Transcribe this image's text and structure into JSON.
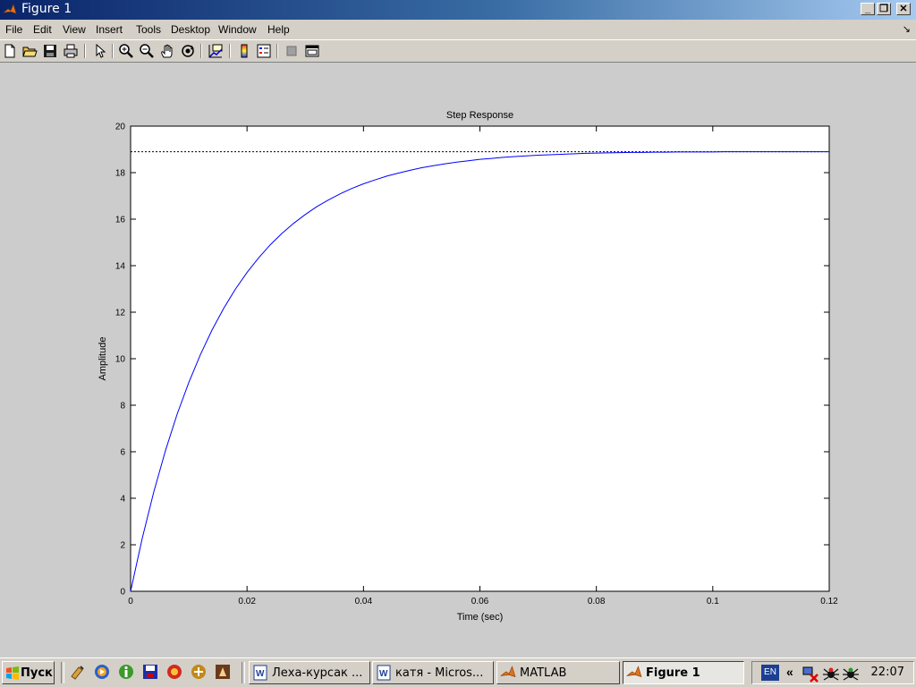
{
  "window": {
    "title": "Figure 1"
  },
  "titlebar_buttons": [
    "_",
    "❐",
    "✕"
  ],
  "menu": {
    "items": [
      "File",
      "Edit",
      "View",
      "Insert",
      "Tools",
      "Desktop",
      "Window",
      "Help"
    ],
    "corner": "↘"
  },
  "toolbar": {
    "icons": [
      "new-figure-icon",
      "open-file-icon",
      "save-icon",
      "print-icon",
      "select-arrow-icon",
      "zoom-in-icon",
      "zoom-out-icon",
      "pan-hand-icon",
      "rotate-3d-icon",
      "data-cursor-icon",
      "insert-colorbar-icon",
      "insert-legend-icon",
      "hide-plot-tools-icon",
      "show-plot-tools-icon"
    ]
  },
  "chart_data": {
    "type": "line",
    "title": "Step Response",
    "xlabel": "Time (sec)",
    "ylabel": "Amplitude",
    "xlim": [
      0,
      0.12
    ],
    "ylim": [
      0,
      20
    ],
    "xticks": [
      "0",
      "0.02",
      "0.04",
      "0.06",
      "0.08",
      "0.1",
      "0.12"
    ],
    "yticks": [
      "0",
      "2",
      "4",
      "6",
      "8",
      "10",
      "12",
      "14",
      "16",
      "18",
      "20"
    ],
    "grid": false,
    "steady_state": 18.9,
    "series": [
      {
        "color": "#0000ff",
        "x": [
          0,
          0.002,
          0.004,
          0.006,
          0.008,
          0.01,
          0.012,
          0.014,
          0.016,
          0.018,
          0.02,
          0.022,
          0.024,
          0.026,
          0.028,
          0.03,
          0.032,
          0.034,
          0.036,
          0.038,
          0.04,
          0.042,
          0.044,
          0.046,
          0.048,
          0.05,
          0.052,
          0.054,
          0.056,
          0.058,
          0.06,
          0.062,
          0.064,
          0.066,
          0.068,
          0.07,
          0.072,
          0.074,
          0.076,
          0.078,
          0.08,
          0.082,
          0.084,
          0.086,
          0.088,
          0.09,
          0.092,
          0.094,
          0.096,
          0.098,
          0.1,
          0.102,
          0.104,
          0.106,
          0.108,
          0.11,
          0.112,
          0.114,
          0.116,
          0.118,
          0.12
        ],
        "y": [
          0,
          2.28,
          4.29,
          6.06,
          7.62,
          8.98,
          10.18,
          11.24,
          12.17,
          12.99,
          13.71,
          14.34,
          14.9,
          15.39,
          15.82,
          16.2,
          16.54,
          16.83,
          17.09,
          17.32,
          17.52,
          17.69,
          17.85,
          17.98,
          18.1,
          18.21,
          18.3,
          18.38,
          18.45,
          18.51,
          18.57,
          18.61,
          18.66,
          18.69,
          18.72,
          18.75,
          18.77,
          18.79,
          18.81,
          18.83,
          18.84,
          18.85,
          18.86,
          18.87,
          18.87,
          18.88,
          18.88,
          18.89,
          18.89,
          18.89,
          18.89,
          18.9,
          18.9,
          18.9,
          18.9,
          18.9,
          18.9,
          18.9,
          18.9,
          18.9,
          18.9
        ]
      }
    ]
  },
  "taskbar": {
    "start_label": "Пуск",
    "quick_launch": [
      "show-desktop-icon",
      "media-player-icon",
      "messenger-icon",
      "save-disk-icon",
      "browser-icon",
      "app-icon",
      "app-icon-2"
    ],
    "buttons": [
      {
        "label": "Леха-курсак ...",
        "icon": "word-icon"
      },
      {
        "label": "катя - Micros...",
        "icon": "word-icon"
      },
      {
        "label": "MATLAB",
        "icon": "matlab-icon"
      },
      {
        "label": "Figure  1",
        "icon": "matlab-icon",
        "active": true
      }
    ],
    "lang": "EN",
    "tray_chevron": "«",
    "clock": "22:07"
  }
}
